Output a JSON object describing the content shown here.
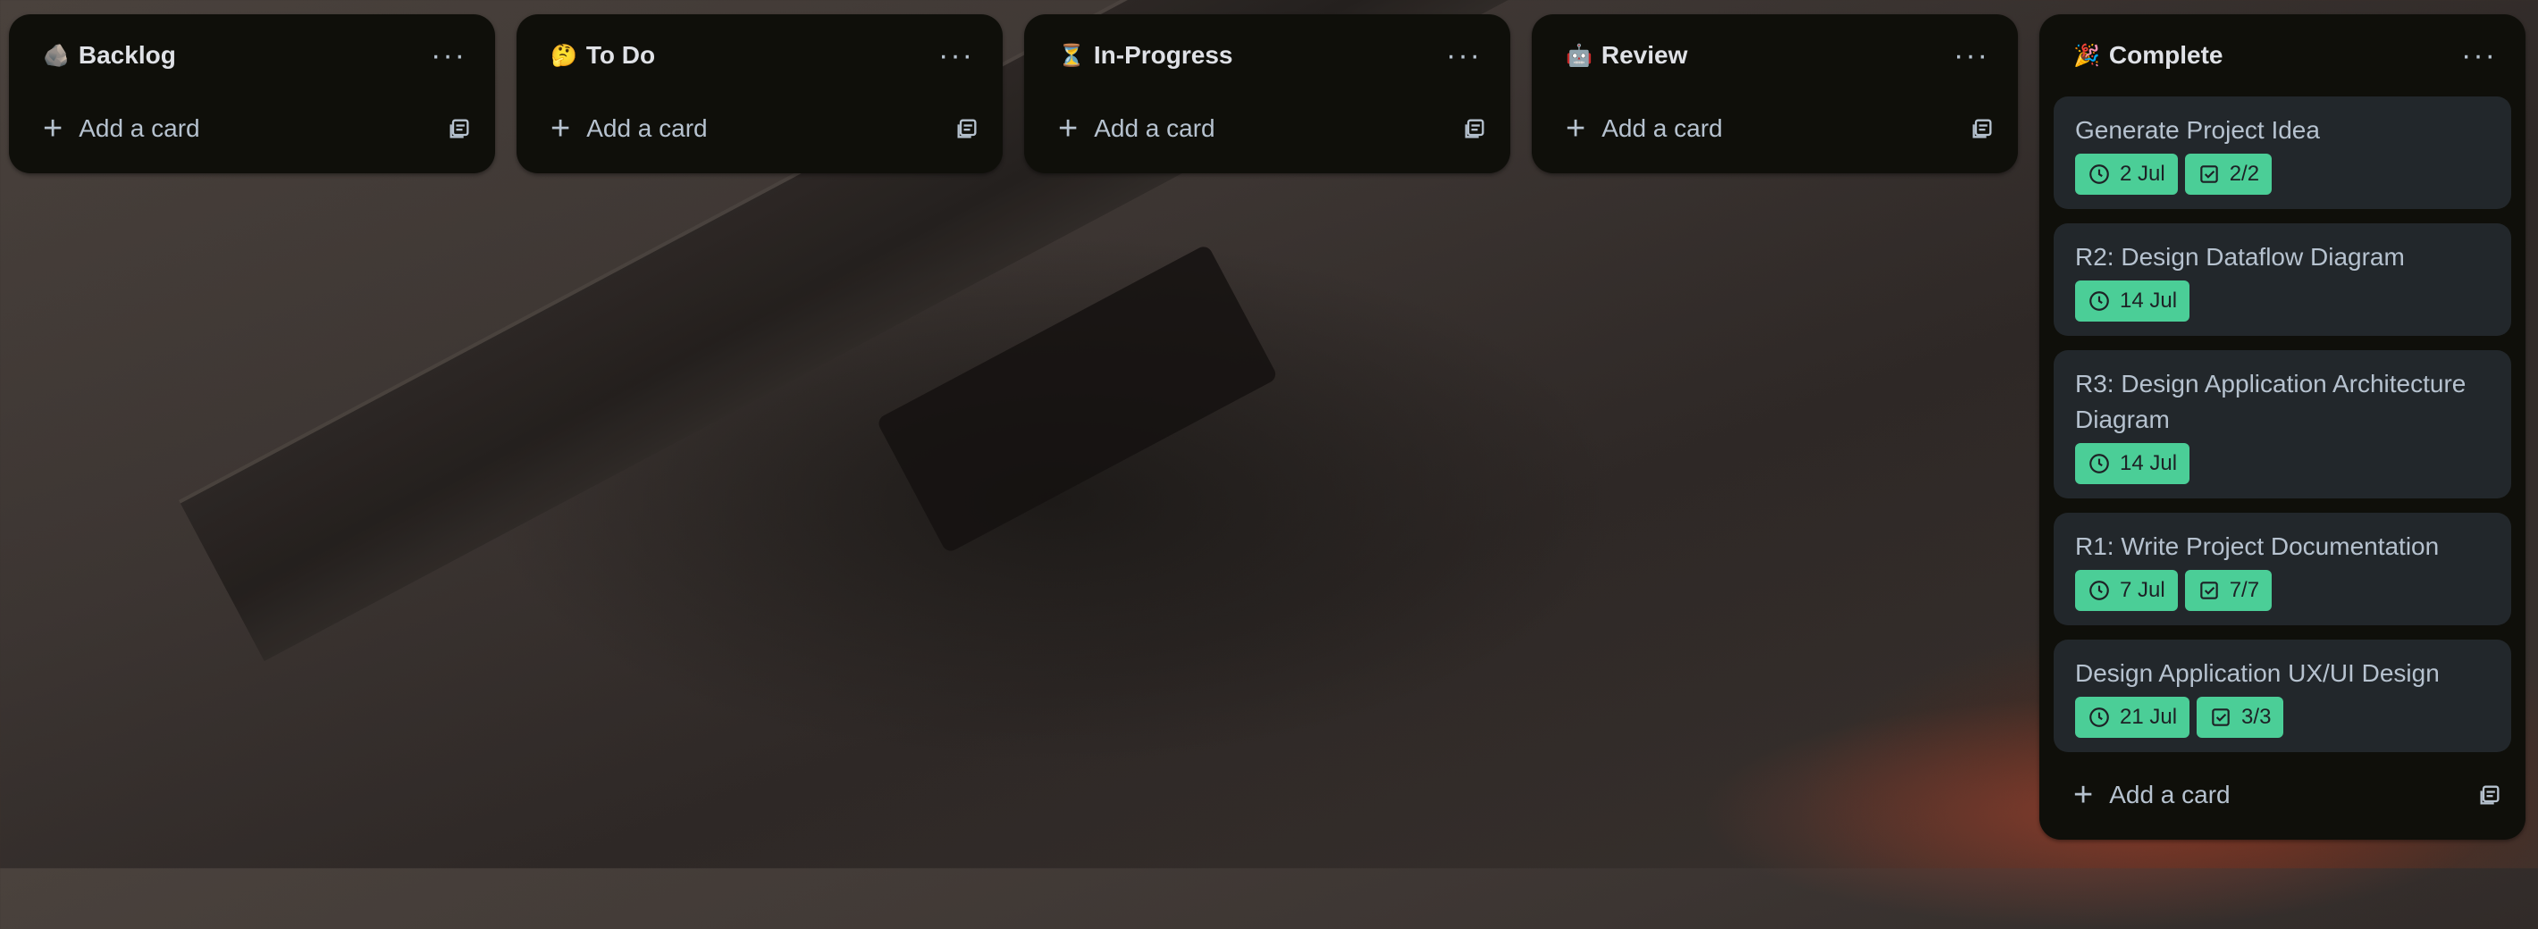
{
  "colors": {
    "list_bg": "#0f0f0a",
    "card_bg": "#22272b",
    "badge_bg": "#4bce97",
    "text": "#b6c2cf"
  },
  "lists": [
    {
      "emoji": "🪨",
      "title": "Backlog",
      "more": "···",
      "add_label": "Add a card",
      "cards": []
    },
    {
      "emoji": "🤔",
      "title": "To Do",
      "more": "···",
      "add_label": "Add a card",
      "cards": []
    },
    {
      "emoji": "⏳",
      "title": "In-Progress",
      "more": "···",
      "add_label": "Add a card",
      "cards": []
    },
    {
      "emoji": "🤖",
      "title": "Review",
      "more": "···",
      "add_label": "Add a card",
      "cards": []
    },
    {
      "emoji": "🎉",
      "title": "Complete",
      "more": "···",
      "add_label": "Add a card",
      "cards": [
        {
          "title": "Generate Project Idea",
          "due": "2 Jul",
          "checklist": "2/2"
        },
        {
          "title": "R2: Design Dataflow Diagram",
          "due": "14 Jul",
          "checklist": ""
        },
        {
          "title": "R3: Design Application Architecture Diagram",
          "due": "14 Jul",
          "checklist": ""
        },
        {
          "title": "R1: Write Project Documentation",
          "due": "7 Jul",
          "checklist": "7/7"
        },
        {
          "title": "Design Application UX/UI Design",
          "due": "21 Jul",
          "checklist": "3/3"
        }
      ]
    }
  ],
  "icons": {
    "due": "clock-icon",
    "checklist": "checkbox-icon",
    "add": "plus-icon",
    "template": "card-template-icon",
    "more": "more-icon"
  }
}
